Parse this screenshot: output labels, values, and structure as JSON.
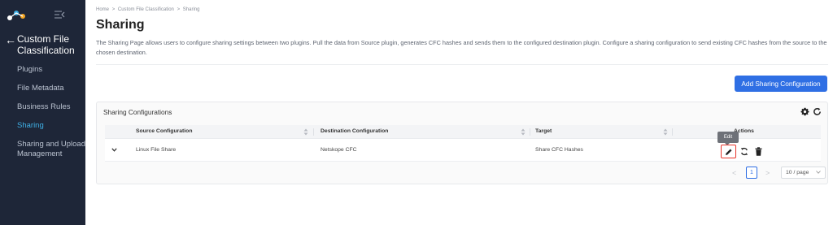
{
  "sidebar": {
    "section_title": "Custom File Classification",
    "items": [
      {
        "label": "Plugins"
      },
      {
        "label": "File Metadata"
      },
      {
        "label": "Business Rules"
      },
      {
        "label": "Sharing"
      },
      {
        "label": "Sharing and Upload Management"
      }
    ],
    "active_color": "#3fb0e6"
  },
  "breadcrumb": {
    "home": "Home",
    "sep1": ">",
    "parent": "Custom File Classification",
    "sep2": ">",
    "current": "Sharing"
  },
  "page": {
    "title": "Sharing",
    "description": "The Sharing Page allows users to configure sharing settings between two plugins. Pull the data from Source plugin, generates CFC hashes and sends them to the configured destination plugin. Configure a sharing configuration to send existing CFC hashes from the source to the chosen destination.",
    "add_button": "Add Sharing Configuration"
  },
  "card": {
    "title": "Sharing Configurations"
  },
  "table": {
    "columns": {
      "source": "Source Configuration",
      "destination": "Destination Configuration",
      "target": "Target",
      "actions": "Actions"
    },
    "rows": [
      {
        "source": "Linux File Share",
        "destination": "Netskope CFC",
        "target": "Share CFC Hashes"
      }
    ]
  },
  "tooltip": {
    "text": "Edit"
  },
  "pagination": {
    "current_page": "1",
    "page_size": "10 / page"
  },
  "colors": {
    "primary": "#2f6fe4",
    "sidebar_bg": "#1e2638",
    "highlight": "#e8342a"
  }
}
